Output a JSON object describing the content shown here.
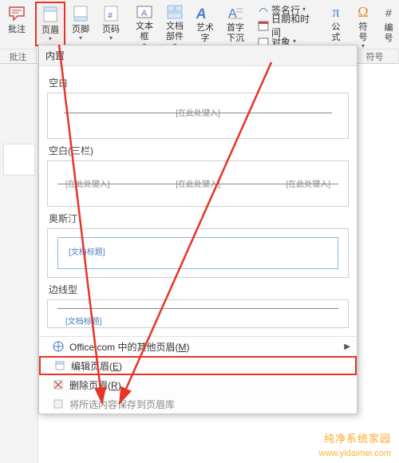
{
  "ribbon": {
    "group_left_label": "批注",
    "comment_label": "批注",
    "header_label": "页眉",
    "footer_label": "页脚",
    "pagenum_label": "页码",
    "textbox_label": "文本框",
    "docpart_label": "文档部件",
    "wordart_label": "艺术字",
    "dropcap_label": "首字下沉",
    "signature_label": "签名行",
    "datetime_label": "日期和时间",
    "object_label": "对象",
    "equation_label": "公式",
    "symbol_label": "符号",
    "group_right_label": "符号",
    "group_mid_label": "批注"
  },
  "dropdown": {
    "builtin_label": "内置",
    "tmpl_blank": "空白",
    "tmpl_blank3": "空白(三栏)",
    "tmpl_austin": "奥斯汀",
    "tmpl_sideline": "边线型",
    "ph_text": "[在此处键入]",
    "ph_doctitle": "[文档标题]",
    "office_more": "Office.com 中的其他页眉",
    "office_more_accel": "M",
    "edit_header": "编辑页眉",
    "edit_header_accel": "E",
    "remove_header": "删除页眉",
    "remove_header_accel": "R",
    "save_to_gallery": "将所选内容保存到页眉库"
  },
  "watermark": {
    "line1": "纯净系统家园",
    "line2": "www.yidaimei.com"
  }
}
